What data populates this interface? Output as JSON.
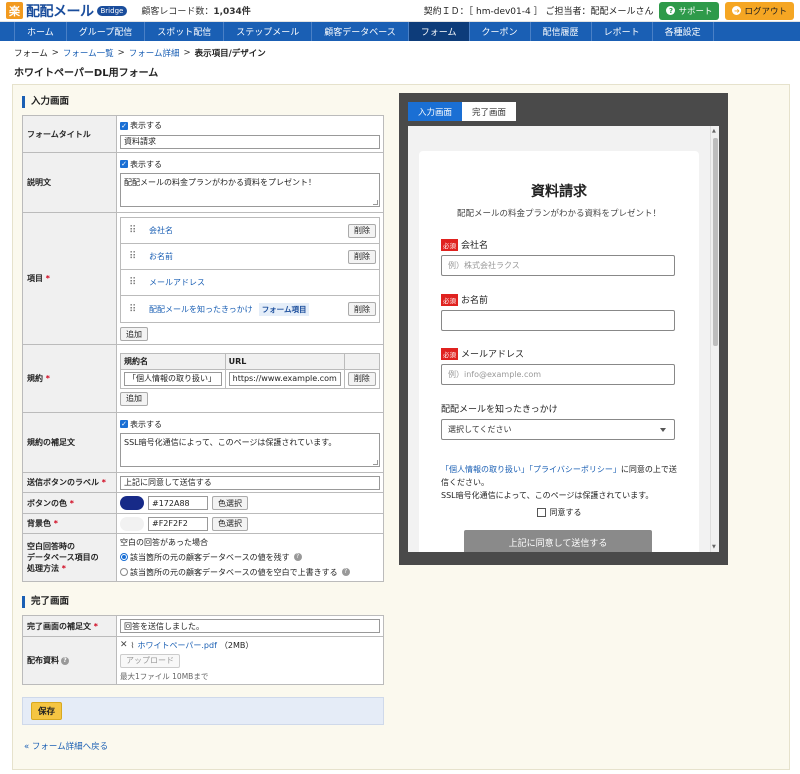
{
  "header": {
    "logo_mark": "楽",
    "logo_text": "配配メール",
    "badge": "Bridge",
    "record_label": "顧客レコード数：",
    "record_count": "1,034件",
    "contract": "契約ＩＤ：［ hm-dev01-4 ］ ご担当者：配配メールさん",
    "support": "サポート",
    "logout": "ログアウト"
  },
  "nav": [
    "ホーム",
    "グループ配信",
    "スポット配信",
    "ステップメール",
    "顧客データベース",
    "フォーム",
    "クーポン",
    "配信履歴",
    "レポート",
    "各種設定"
  ],
  "nav_active": "フォーム",
  "breadcrumb": {
    "b1": "フォーム",
    "b2": "フォーム一覧",
    "b3": "フォーム詳細",
    "current": "表示項目/デザイン",
    "sep": ">"
  },
  "page_title": "ホワイトペーパーDL用フォーム",
  "input_section": {
    "heading": "入力画面",
    "show_label": "表示する",
    "form_title_label": "フォームタイトル",
    "form_title_value": "資料請求",
    "description_label": "説明文",
    "description_value": "配配メールの料金プランがわかる資料をプレゼント！",
    "items_label": "項目",
    "items": [
      {
        "name": "会社名",
        "tag": "",
        "delete": "削除"
      },
      {
        "name": "お名前",
        "tag": "",
        "delete": "削除"
      },
      {
        "name": "メールアドレス",
        "tag": "",
        "delete": ""
      },
      {
        "name": "配配メールを知ったきっかけ",
        "tag": "フォーム項目",
        "delete": "削除"
      }
    ],
    "add": "追加",
    "terms_label": "規約",
    "terms_col_name": "規約名",
    "terms_col_url": "URL",
    "terms_name": "「個人情報の取り扱い」",
    "terms_url": "https://www.example.com",
    "terms_delete": "削除",
    "terms_note_label": "規約の補足文",
    "terms_note_value": "SSL暗号化通信によって、このページは保護されています。",
    "submit_label_label": "送信ボタンのラベル",
    "submit_label_value": "上記に同意して送信する",
    "button_color_label": "ボタンの色",
    "button_color": "#172A88",
    "bg_color_label": "背景色",
    "bg_color": "#F2F2F2",
    "pick_color": "色選択",
    "blank_label_1": "空白回答時の",
    "blank_label_2": "データベース項目の",
    "blank_label_3": "処理方法",
    "blank_head": "空白の回答があった場合",
    "blank_opt1": "該当箇所の元の顧客データベースの値を残す",
    "blank_opt2": "該当箇所の元の顧客データベースの値を空白で上書きする"
  },
  "complete_section": {
    "heading": "完了画面",
    "note_label": "完了画面の補足文",
    "note_value": "回答を送信しました。",
    "file_label": "配布資料",
    "file_name": "ホワイトペーパー.pdf",
    "file_size": "（2MB）",
    "upload": "アップロード",
    "limit": "最大1ファイル 10MBまで"
  },
  "save": "保存",
  "back": "フォーム詳細へ戻る",
  "preview": {
    "tab_input": "入力画面",
    "tab_complete": "完了画面",
    "title": "資料請求",
    "desc": "配配メールの料金プランがわかる資料をプレゼント！",
    "required": "必須",
    "f1_label": "会社名",
    "f1_placeholder": "例）株式会社ラクス",
    "f2_label": "お名前",
    "f2_placeholder": "",
    "f3_label": "メールアドレス",
    "f3_placeholder": "例）info@example.com",
    "f4_label": "配配メールを知ったきっかけ",
    "f4_select": "選択してください",
    "terms_link1": "「個人情報の取り扱い」",
    "terms_link2": "「プライバシーポリシー」",
    "terms_text": "に同意の上で送信ください。",
    "ssl": "SSL暗号化通信によって、このページは保護されています。",
    "agree": "同意する",
    "submit": "上記に同意して送信する"
  },
  "colors": {
    "nav": "#1a5fb4",
    "button_color_swatch": "#172A88",
    "bg_color_swatch": "#F2F2F2"
  }
}
